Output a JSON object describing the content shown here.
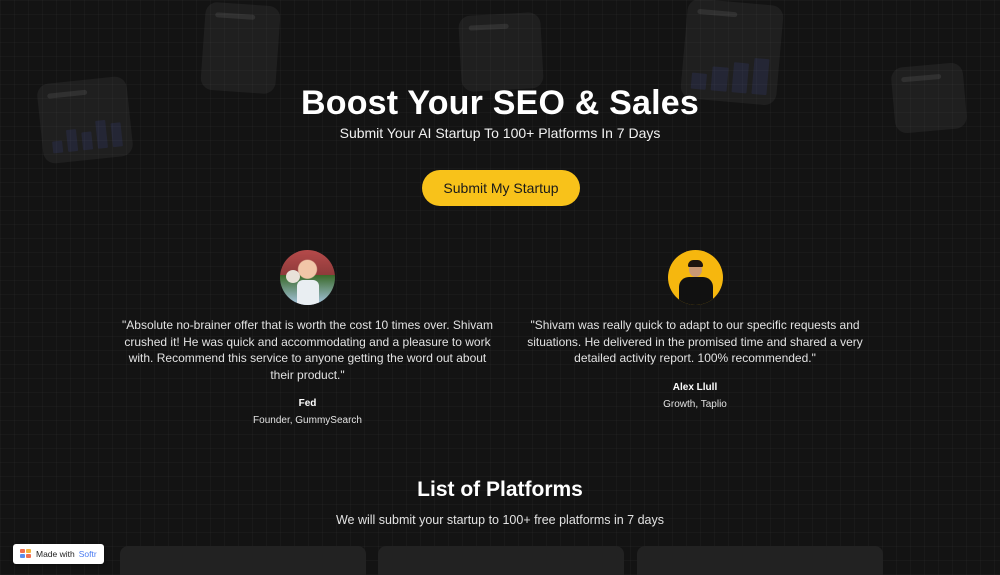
{
  "hero": {
    "title": "Boost Your SEO & Sales",
    "subtitle": "Submit Your AI Startup To 100+ Platforms In 7 Days",
    "cta_label": "Submit My Startup"
  },
  "testimonials": [
    {
      "quote": "\"Absolute no-brainer offer that is worth the cost 10 times over. Shivam crushed it! He was quick and accommodating and a pleasure to work with. Recommend this service to anyone getting the word out about their product.\"",
      "author": "Fed",
      "role": "Founder, GummySearch"
    },
    {
      "quote": "\"Shivam was really quick to adapt to our specific requests and situations. He delivered in the promised time and shared a very detailed activity report. 100% recommended.\"",
      "author": "Alex Llull",
      "role": "Growth, Taplio"
    }
  ],
  "platforms_section": {
    "title": "List of Platforms",
    "subtitle": "We will submit your startup to 100+ free platforms in 7 days"
  },
  "badge": {
    "text": "Made with",
    "brand": "Softr"
  },
  "colors": {
    "accent": "#f8c21a",
    "background": "#131313",
    "card": "#222222"
  }
}
